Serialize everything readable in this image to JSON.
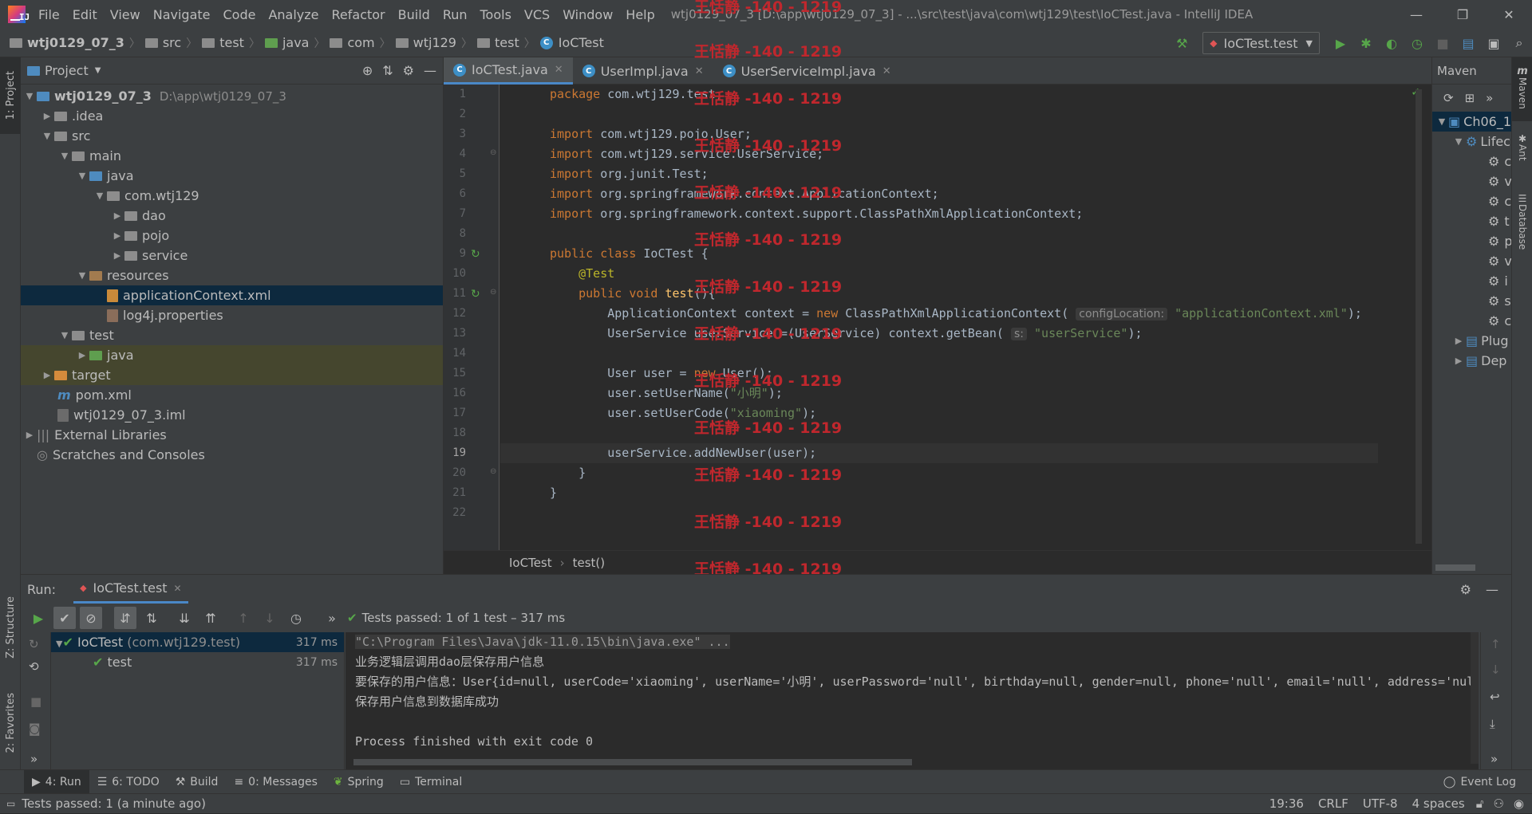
{
  "menubar": {
    "items": [
      "File",
      "Edit",
      "View",
      "Navigate",
      "Code",
      "Analyze",
      "Refactor",
      "Build",
      "Run",
      "Tools",
      "VCS",
      "Window",
      "Help"
    ],
    "window_title": "wtj0129_07_3 [D:\\app\\wtj0129_07_3] - ...\\src\\test\\java\\com\\wtj129\\test\\IoCTest.java - IntelliJ IDEA",
    "logo_letters": "IJ"
  },
  "breadcrumb": [
    "wtj0129_07_3",
    "src",
    "test",
    "java",
    "com",
    "wtj129",
    "test",
    "IoCTest"
  ],
  "run_config": "IoCTest.test",
  "project_panel": {
    "title": "Project",
    "tree": [
      {
        "label": "wtj0129_07_3",
        "hint": "D:\\app\\wtj0129_07_3",
        "depth": 0,
        "arrow": "▼"
      },
      {
        "label": ".idea",
        "depth": 1,
        "arrow": "▶"
      },
      {
        "label": "src",
        "depth": 1,
        "arrow": "▼"
      },
      {
        "label": "main",
        "depth": 2,
        "arrow": "▼"
      },
      {
        "label": "java",
        "depth": 3,
        "arrow": "▼"
      },
      {
        "label": "com.wtj129",
        "depth": 4,
        "arrow": "▼"
      },
      {
        "label": "dao",
        "depth": 5,
        "arrow": "▶"
      },
      {
        "label": "pojo",
        "depth": 5,
        "arrow": "▶"
      },
      {
        "label": "service",
        "depth": 5,
        "arrow": "▶"
      },
      {
        "label": "resources",
        "depth": 3,
        "arrow": "▼"
      },
      {
        "label": "applicationContext.xml",
        "depth": 4,
        "arrow": ""
      },
      {
        "label": "log4j.properties",
        "depth": 4,
        "arrow": ""
      },
      {
        "label": "test",
        "depth": 2,
        "arrow": "▼"
      },
      {
        "label": "java",
        "depth": 3,
        "arrow": "▶"
      },
      {
        "label": "target",
        "depth": 1,
        "arrow": "▶"
      },
      {
        "label": "pom.xml",
        "depth": 1,
        "arrow": ""
      },
      {
        "label": "wtj0129_07_3.iml",
        "depth": 1,
        "arrow": ""
      },
      {
        "label": "External Libraries",
        "depth": 0,
        "arrow": "▶"
      },
      {
        "label": "Scratches and Consoles",
        "depth": 0,
        "arrow": ""
      }
    ]
  },
  "editor": {
    "tabs": [
      "IoCTest.java",
      "UserImpl.java",
      "UserServiceImpl.java"
    ],
    "line_numbers": [
      "1",
      "2",
      "3",
      "4",
      "5",
      "6",
      "7",
      "8",
      "9",
      "10",
      "11",
      "12",
      "13",
      "14",
      "15",
      "16",
      "17",
      "18",
      "19",
      "20",
      "21",
      "22"
    ],
    "code": {
      "l1": "com.wtj129.test;",
      "l3": "com.wtj129.pojo.User;",
      "l4": "com.wtj129.service.UserService;",
      "l5": "org.junit.Test;",
      "l6": "org.springframework.context.ApplicationContext;",
      "l7": "org.springframework.context.support.ClassPathXmlApplicationContext;",
      "l9": "IoCTest {",
      "l10": "@Test",
      "l11_fn": "test",
      "l12_a": "ApplicationContext context = ",
      "l12_b": " ClassPathXmlApplicationContext(",
      "l12_hint": "configLocation:",
      "l12_str": "\"applicationContext.xml\"",
      "l13_a": "UserService userService =(UserService) context.getBean(",
      "l13_hint": "s:",
      "l13_str": "\"userService\"",
      "l15_a": "User user = ",
      "l15_b": " User();",
      "l16_a": "user.setUserName(",
      "l16_str": "\"小明\"",
      "l17_a": "user.setUserCode(",
      "l17_str": "\"xiaoming\"",
      "l19": "userService.addNewUser(user);",
      "l20": "}",
      "l21": "}"
    },
    "keywords": {
      "package": "package",
      "import": "import",
      "public": "public",
      "class": "class",
      "void": "void",
      "new": "new"
    },
    "breadcrumb_class": "IoCTest",
    "breadcrumb_method": "test()"
  },
  "watermark": "王恬静 -140 - 1219",
  "maven": {
    "title": "Maven",
    "items": [
      "Ch06_1",
      "Lifec",
      "c",
      "v",
      "c",
      "t",
      "p",
      "v",
      "i",
      "s",
      "c",
      "Plug",
      "Dep"
    ]
  },
  "run_panel": {
    "label": "Run:",
    "tab": "IoCTest.test",
    "status": "Tests passed:",
    "status_count": "1",
    "status_tail": "of 1 test – 317 ms",
    "tests": [
      {
        "name": "IoCTest",
        "pkg": "(com.wtj129.test)",
        "time": "317 ms"
      },
      {
        "name": "test",
        "pkg": "",
        "time": "317 ms"
      }
    ],
    "console": [
      "\"C:\\Program Files\\Java\\jdk-11.0.15\\bin\\java.exe\" ...",
      "业务逻辑层调用dao层保存用户信息",
      "要保存的用户信息：User{id=null, userCode='xiaoming', userName='小明', userPassword='null', birthday=null, gender=null, phone='null', email='null', address='nul",
      "保存用户信息到数据库成功",
      "",
      "Process finished with exit code 0"
    ]
  },
  "left_strip": {
    "project": "1: Project",
    "structure": "Z: Structure",
    "favorites": "2: Favorites"
  },
  "right_strip": {
    "maven": "Maven",
    "ant": "Ant",
    "database": "Database"
  },
  "tool_windows": [
    "4: Run",
    "6: TODO",
    "Build",
    "0: Messages",
    "Spring",
    "Terminal"
  ],
  "event_log": "Event Log",
  "statusbar": {
    "message": "Tests passed: 1 (a minute ago)",
    "position": "19:36",
    "line_sep": "CRLF",
    "encoding": "UTF-8",
    "indent": "4 spaces"
  },
  "colors": {
    "bg": "#2b2b2b",
    "panel": "#3c3f41",
    "keyword": "#cc7832",
    "string": "#6a8759",
    "annotation": "#bbb529",
    "selection": "#0d293e",
    "accent": "#4a88c7",
    "watermark": "#c0272d"
  }
}
